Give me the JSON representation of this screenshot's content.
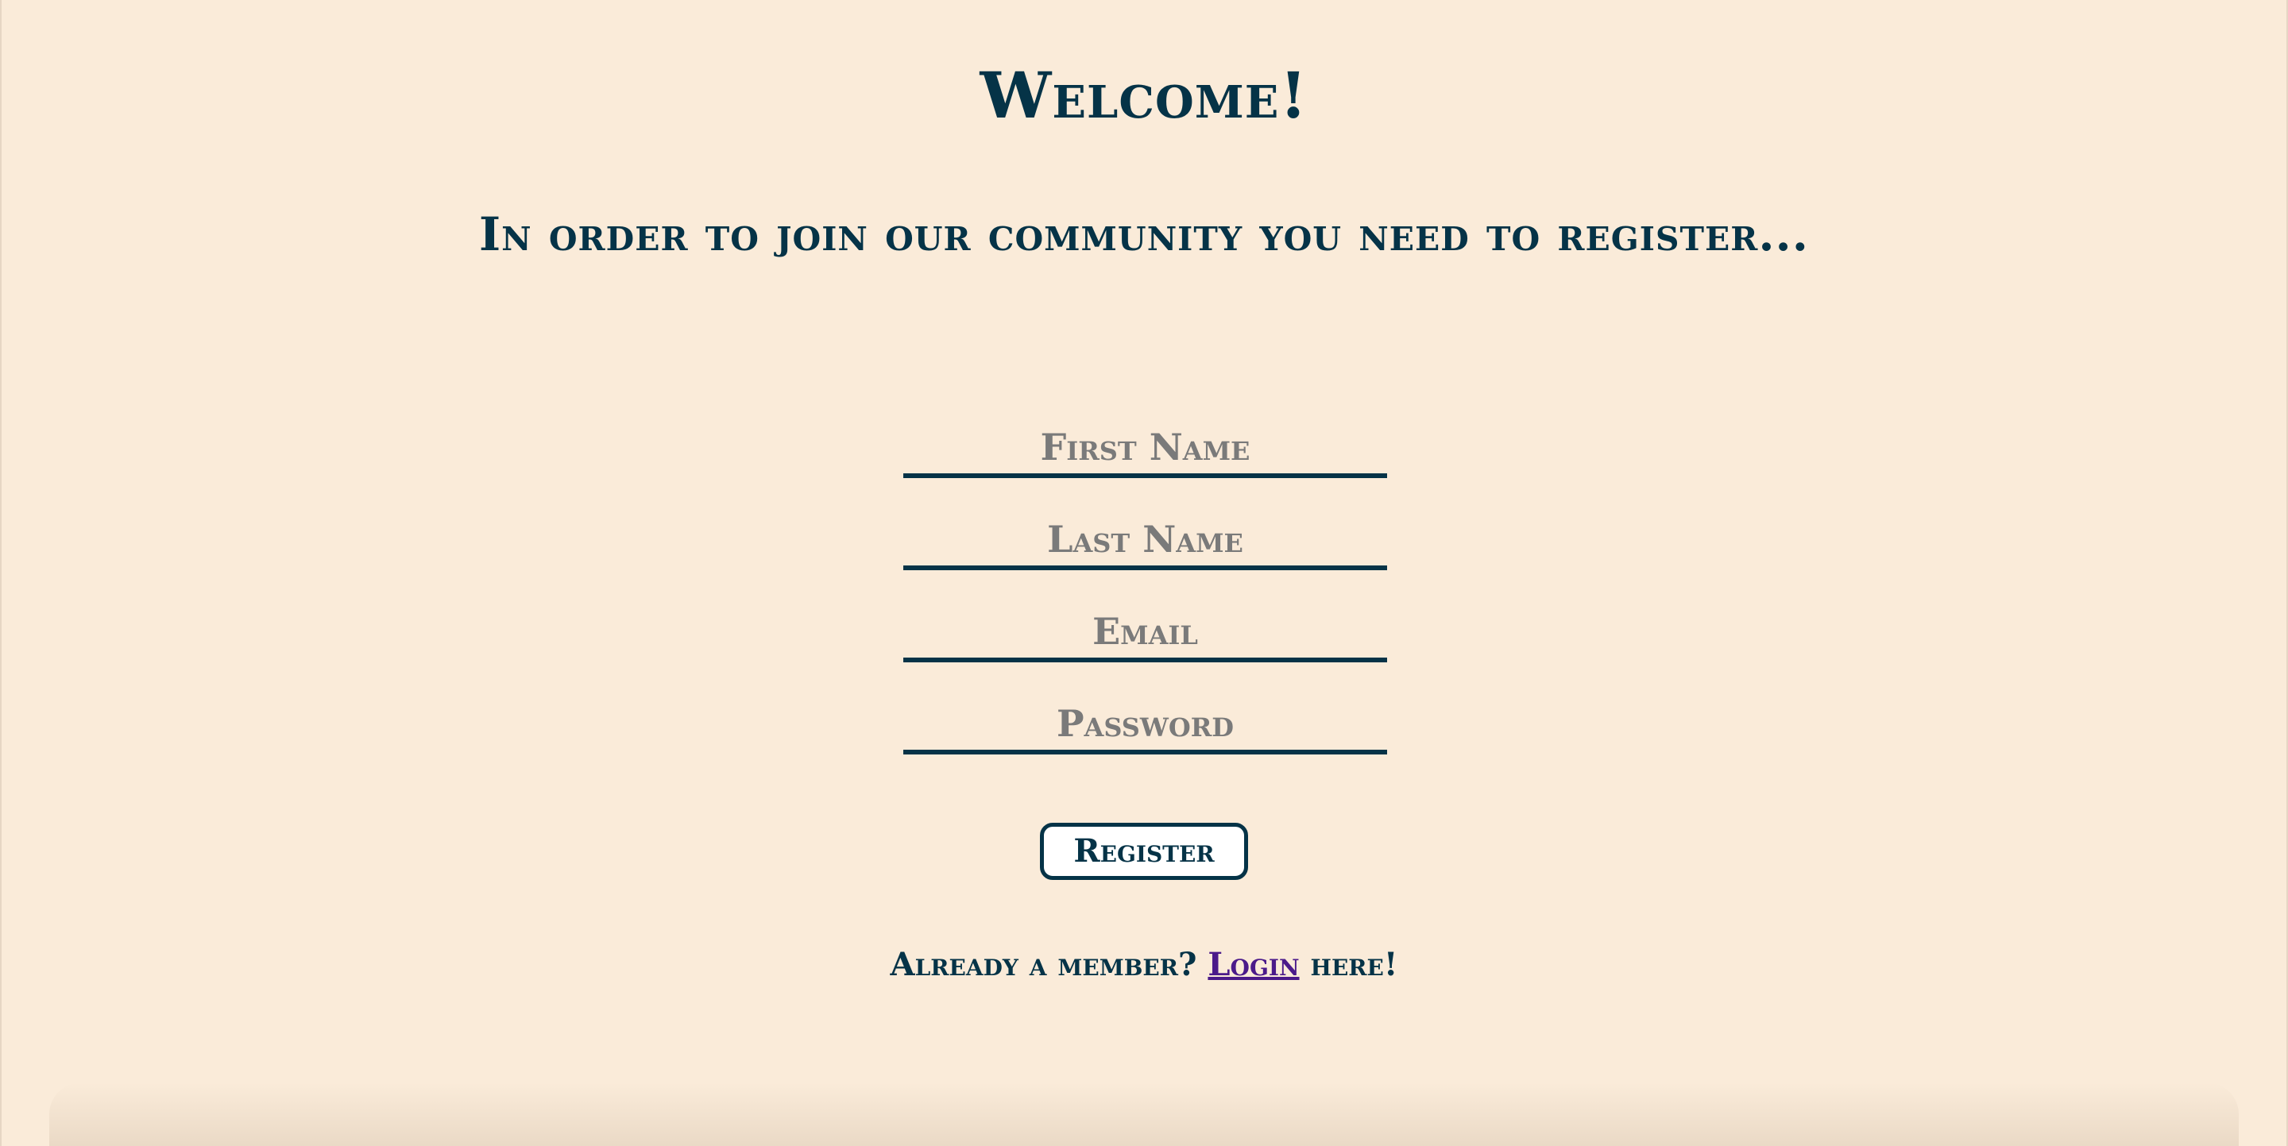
{
  "header": {
    "title": "Welcome!",
    "subtitle": "In order to join our community you need to register..."
  },
  "form": {
    "first_name": {
      "placeholder": "First Name",
      "value": ""
    },
    "last_name": {
      "placeholder": "Last Name",
      "value": ""
    },
    "email": {
      "placeholder": "Email",
      "value": ""
    },
    "password": {
      "placeholder": "Password",
      "value": ""
    },
    "register_label": "Register"
  },
  "footer": {
    "prefix": "Already a member?",
    "login_link": "Login",
    "suffix": "here!"
  },
  "colors": {
    "background": "#faebd9",
    "primary": "#053347",
    "placeholder": "#7a7a7a",
    "link": "#4b1a8a"
  }
}
